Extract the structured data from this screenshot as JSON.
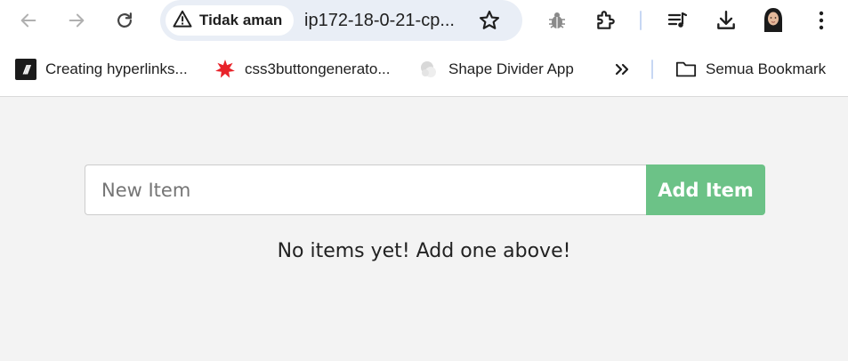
{
  "browser": {
    "security_label": "Tidak aman",
    "url": "ip172-18-0-21-cp...",
    "icons": {
      "back": "arrow-left",
      "forward": "arrow-right",
      "reload": "reload",
      "warning": "warning-triangle",
      "star": "star-outline",
      "bug_extension": "bug",
      "extensions": "puzzle",
      "media": "music-queue",
      "downloads": "download",
      "profile": "avatar",
      "menu": "three-dot-vertical"
    }
  },
  "bookmarks": {
    "items": [
      {
        "label": "Creating hyperlinks...",
        "icon": "M-logo"
      },
      {
        "label": "css3buttongenerato...",
        "icon": "red-star"
      },
      {
        "label": "Shape Divider App",
        "icon": "shape-divider-logo"
      }
    ],
    "overflow_icon": "double-chevron-right",
    "all_bookmarks": {
      "label": "Semua Bookmark",
      "icon": "folder"
    }
  },
  "app": {
    "input_placeholder": "New Item",
    "input_value": "",
    "add_button_label": "Add Item",
    "empty_message": "No items yet! Add one above!",
    "colors": {
      "accent": "#6cc287",
      "background": "#f3f3f3"
    }
  }
}
